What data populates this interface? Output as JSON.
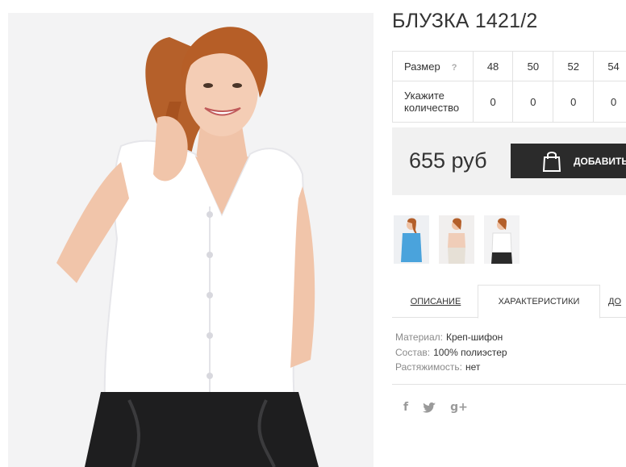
{
  "product": {
    "title": "БЛУЗКА 1421/2"
  },
  "size_table": {
    "size_label": "Размер",
    "help_icon": "?",
    "sizes": [
      "48",
      "50",
      "52",
      "54"
    ],
    "qty_label_line1": "Укажите",
    "qty_label_line2": "количество",
    "quantities": [
      "0",
      "0",
      "0",
      "0"
    ]
  },
  "buy": {
    "price": "655 руб",
    "add_button_label": "ДОБАВИТЬ В",
    "icon": "shopping-bag-icon"
  },
  "thumbnails": [
    "blue-top-thumb",
    "peach-top-thumb",
    "white-blouse-thumb"
  ],
  "tabs": {
    "description": "ОПИСАНИЕ",
    "characteristics": "ХАРАКТЕРИСТИКИ",
    "more": "ДО"
  },
  "specs": [
    {
      "key": "Материал:",
      "value": "Креп-шифон"
    },
    {
      "key": "Состав:",
      "value": "100% полиэстер"
    },
    {
      "key": "Растяжимость:",
      "value": "нет"
    }
  ],
  "social": {
    "facebook": "f",
    "twitter": "twitter-icon",
    "googleplus": "g+"
  },
  "colors": {
    "button_bg": "#2b2b2b",
    "panel_bg": "#f1f1f1",
    "border": "#e2e2e2"
  }
}
